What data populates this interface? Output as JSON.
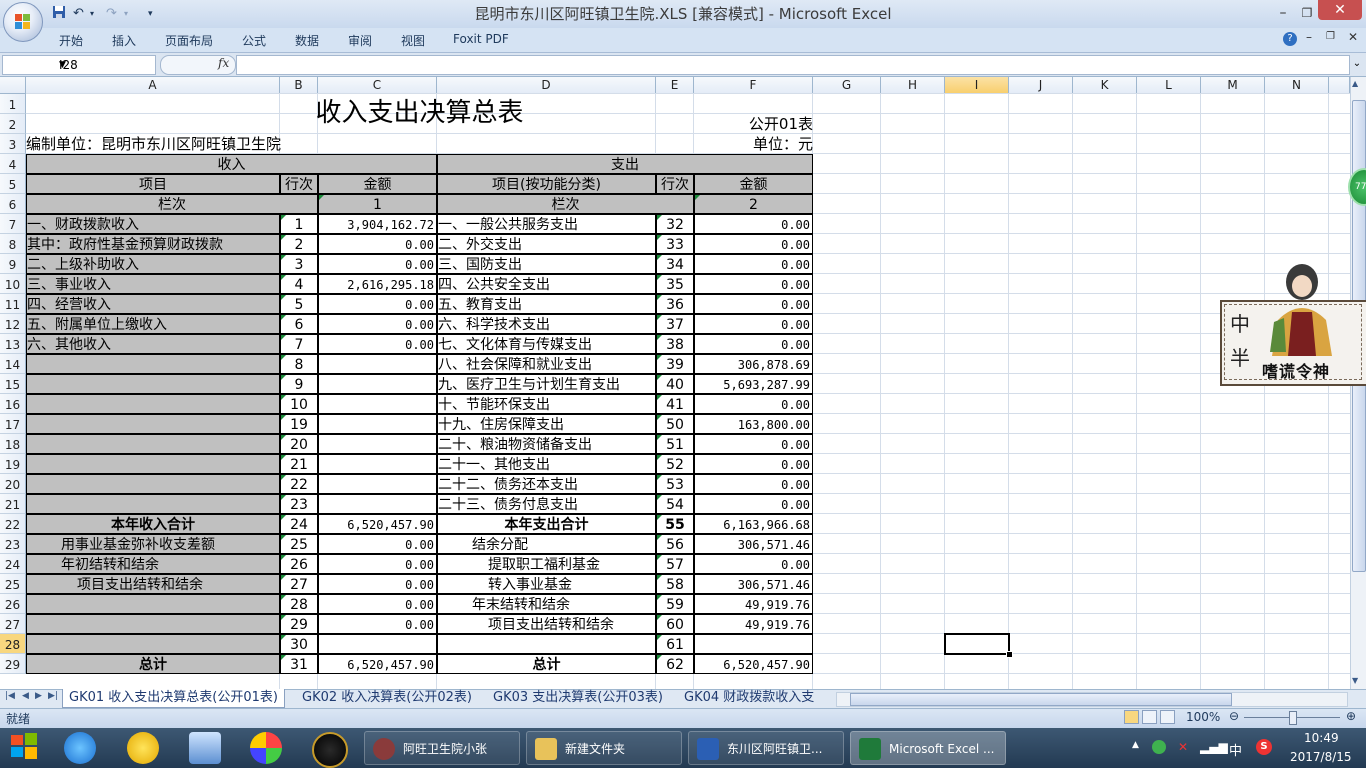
{
  "window": {
    "title": "昆明市东川区阿旺镇卫生院.XLS  [兼容模式] - Microsoft Excel"
  },
  "ribbon": {
    "tabs": [
      "开始",
      "插入",
      "页面布局",
      "公式",
      "数据",
      "审阅",
      "视图",
      "Foxit PDF"
    ]
  },
  "formula_bar": {
    "name_box": "I28",
    "fx": "fx",
    "content": ""
  },
  "columns": [
    "A",
    "B",
    "C",
    "D",
    "E",
    "F",
    "G",
    "H",
    "I",
    "J",
    "K",
    "L",
    "M",
    "N"
  ],
  "rows": [
    "1",
    "2",
    "3",
    "4",
    "5",
    "6",
    "7",
    "8",
    "9",
    "10",
    "11",
    "12",
    "13",
    "14",
    "15",
    "16",
    "17",
    "18",
    "19",
    "20",
    "21",
    "22",
    "23",
    "24",
    "25",
    "26",
    "27",
    "28",
    "29"
  ],
  "sheet": {
    "title": "收入支出决算总表",
    "form_no": "公开01表",
    "unit": "单位：元",
    "org": "编制单位：昆明市东川区阿旺镇卫生院",
    "income_header": "收入",
    "expense_header": "支出",
    "col_item": "项目",
    "col_line": "行次",
    "col_amount": "金额",
    "col_item_func": "项目(按功能分类)",
    "col_line2": "行次",
    "col_amount2": "金额",
    "lanci": "栏次",
    "lanci2": "栏次",
    "lanci_val1": "1",
    "lanci_val2": "2",
    "table_rows": [
      {
        "a": "一、财政拨款收入",
        "b": "1",
        "c": "3,904,162.72",
        "d": "一、一般公共服务支出",
        "e": "32",
        "f": "0.00"
      },
      {
        "a": "    其中：政府性基金预算财政拨款",
        "b": "2",
        "c": "0.00",
        "d": "二、外交支出",
        "e": "33",
        "f": "0.00"
      },
      {
        "a": "二、上级补助收入",
        "b": "3",
        "c": "0.00",
        "d": "三、国防支出",
        "e": "34",
        "f": "0.00"
      },
      {
        "a": "三、事业收入",
        "b": "4",
        "c": "2,616,295.18",
        "d": "四、公共安全支出",
        "e": "35",
        "f": "0.00"
      },
      {
        "a": "四、经营收入",
        "b": "5",
        "c": "0.00",
        "d": "五、教育支出",
        "e": "36",
        "f": "0.00"
      },
      {
        "a": "五、附属单位上缴收入",
        "b": "6",
        "c": "0.00",
        "d": "六、科学技术支出",
        "e": "37",
        "f": "0.00"
      },
      {
        "a": "六、其他收入",
        "b": "7",
        "c": "0.00",
        "d": "七、文化体育与传媒支出",
        "e": "38",
        "f": "0.00"
      },
      {
        "a": "",
        "b": "8",
        "c": "",
        "d": "八、社会保障和就业支出",
        "e": "39",
        "f": "306,878.69"
      },
      {
        "a": "",
        "b": "9",
        "c": "",
        "d": "九、医疗卫生与计划生育支出",
        "e": "40",
        "f": "5,693,287.99"
      },
      {
        "a": "",
        "b": "10",
        "c": "",
        "d": "十、节能环保支出",
        "e": "41",
        "f": "0.00"
      },
      {
        "a": "",
        "b": "19",
        "c": "",
        "d": "十九、住房保障支出",
        "e": "50",
        "f": "163,800.00"
      },
      {
        "a": "",
        "b": "20",
        "c": "",
        "d": "二十、粮油物资储备支出",
        "e": "51",
        "f": "0.00"
      },
      {
        "a": "",
        "b": "21",
        "c": "",
        "d": "二十一、其他支出",
        "e": "52",
        "f": "0.00"
      },
      {
        "a": "",
        "b": "22",
        "c": "",
        "d": "二十二、债务还本支出",
        "e": "53",
        "f": "0.00"
      },
      {
        "a": "",
        "b": "23",
        "c": "",
        "d": "二十三、债务付息支出",
        "e": "54",
        "f": "0.00"
      },
      {
        "a": "本年收入合计",
        "b": "24",
        "c": "6,520,457.90",
        "d": "本年支出合计",
        "e": "55",
        "f": "6,163,966.68"
      },
      {
        "a": "用事业基金弥补收支差额",
        "b": "25",
        "c": "0.00",
        "d": "结余分配",
        "e": "56",
        "f": "306,571.46"
      },
      {
        "a": "年初结转和结余",
        "b": "26",
        "c": "0.00",
        "d": "提取职工福利基金",
        "e": "57",
        "f": "0.00"
      },
      {
        "a": "项目支出结转和结余",
        "b": "27",
        "c": "0.00",
        "d": "转入事业基金",
        "e": "58",
        "f": "306,571.46"
      },
      {
        "a": "",
        "b": "28",
        "c": "0.00",
        "d": "年末结转和结余",
        "e": "59",
        "f": "49,919.76"
      },
      {
        "a": "",
        "b": "29",
        "c": "0.00",
        "d": "项目支出结转和结余",
        "e": "60",
        "f": "49,919.76"
      },
      {
        "a": "",
        "b": "30",
        "c": "",
        "d": "",
        "e": "61",
        "f": ""
      },
      {
        "a": "总计",
        "b": "31",
        "c": "6,520,457.90",
        "d": "总计",
        "e": "62",
        "f": "6,520,457.90"
      }
    ]
  },
  "sheet_tabs": [
    "GK01 收入支出决算总表(公开01表)",
    "GK02 收入决算表(公开02表)",
    "GK03 支出决算表(公开03表)",
    "GK04 财政拨款收入支"
  ],
  "status": {
    "ready": "就绪",
    "zoom": "100%"
  },
  "taskbar": {
    "items": [
      "阿旺卫生院小张",
      "新建文件夹",
      "东川区阿旺镇卫...",
      "Microsoft Excel ..."
    ],
    "time": "10:49",
    "date": "2017/8/15",
    "ime": "中"
  },
  "overlay": {
    "badge": "77",
    "mascot_line1": "中",
    "mascot_line2": "半",
    "mascot_caption": "嗜谎令神"
  }
}
